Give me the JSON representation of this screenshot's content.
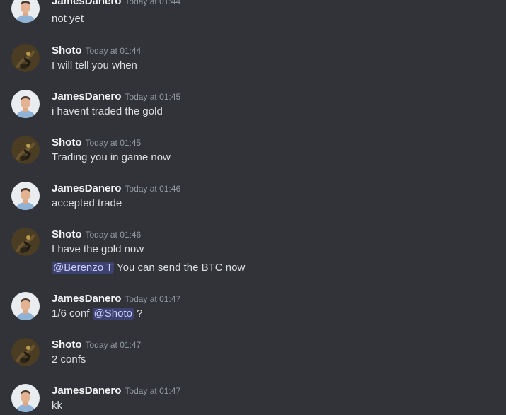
{
  "messages": [
    {
      "author": "JamesDanero",
      "avatar": "james-avatar",
      "time": "Today at 01:44",
      "lines": [
        "not yet"
      ]
    },
    {
      "author": "Shoto",
      "avatar": "shoto-avatar",
      "time": "Today at 01:44",
      "lines": [
        "I will tell you when"
      ]
    },
    {
      "author": "JamesDanero",
      "avatar": "james-avatar",
      "time": "Today at 01:45",
      "lines": [
        "i havent traded the gold"
      ]
    },
    {
      "author": "Shoto",
      "avatar": "shoto-avatar",
      "time": "Today at 01:45",
      "lines": [
        "Trading you in game now"
      ]
    },
    {
      "author": "JamesDanero",
      "avatar": "james-avatar",
      "time": "Today at 01:46",
      "lines": [
        "accepted trade"
      ]
    },
    {
      "author": "Shoto",
      "avatar": "shoto-avatar",
      "time": "Today at 01:46",
      "lines": [
        "I have the gold now"
      ],
      "extra": {
        "mention": "@Berenzo T",
        "text": " You can send the BTC now"
      }
    },
    {
      "author": "JamesDanero",
      "avatar": "james-avatar",
      "time": "Today at 01:47",
      "lines": [],
      "mixed": {
        "before": "1/6 conf ",
        "mention": "@Shoto",
        "after": " ?"
      }
    },
    {
      "author": "Shoto",
      "avatar": "shoto-avatar",
      "time": "Today at 01:47",
      "lines": [
        "2 confs"
      ]
    },
    {
      "author": "JamesDanero",
      "avatar": "james-avatar",
      "time": "Today at 01:47",
      "lines": [
        "kk"
      ]
    }
  ],
  "colors": {
    "background": "#313338",
    "username": "#f2f3f5",
    "timestamp": "#949ba4",
    "text": "#dbdee1",
    "mention_bg": "#3c4270",
    "mention_text": "#c9cdfb"
  }
}
